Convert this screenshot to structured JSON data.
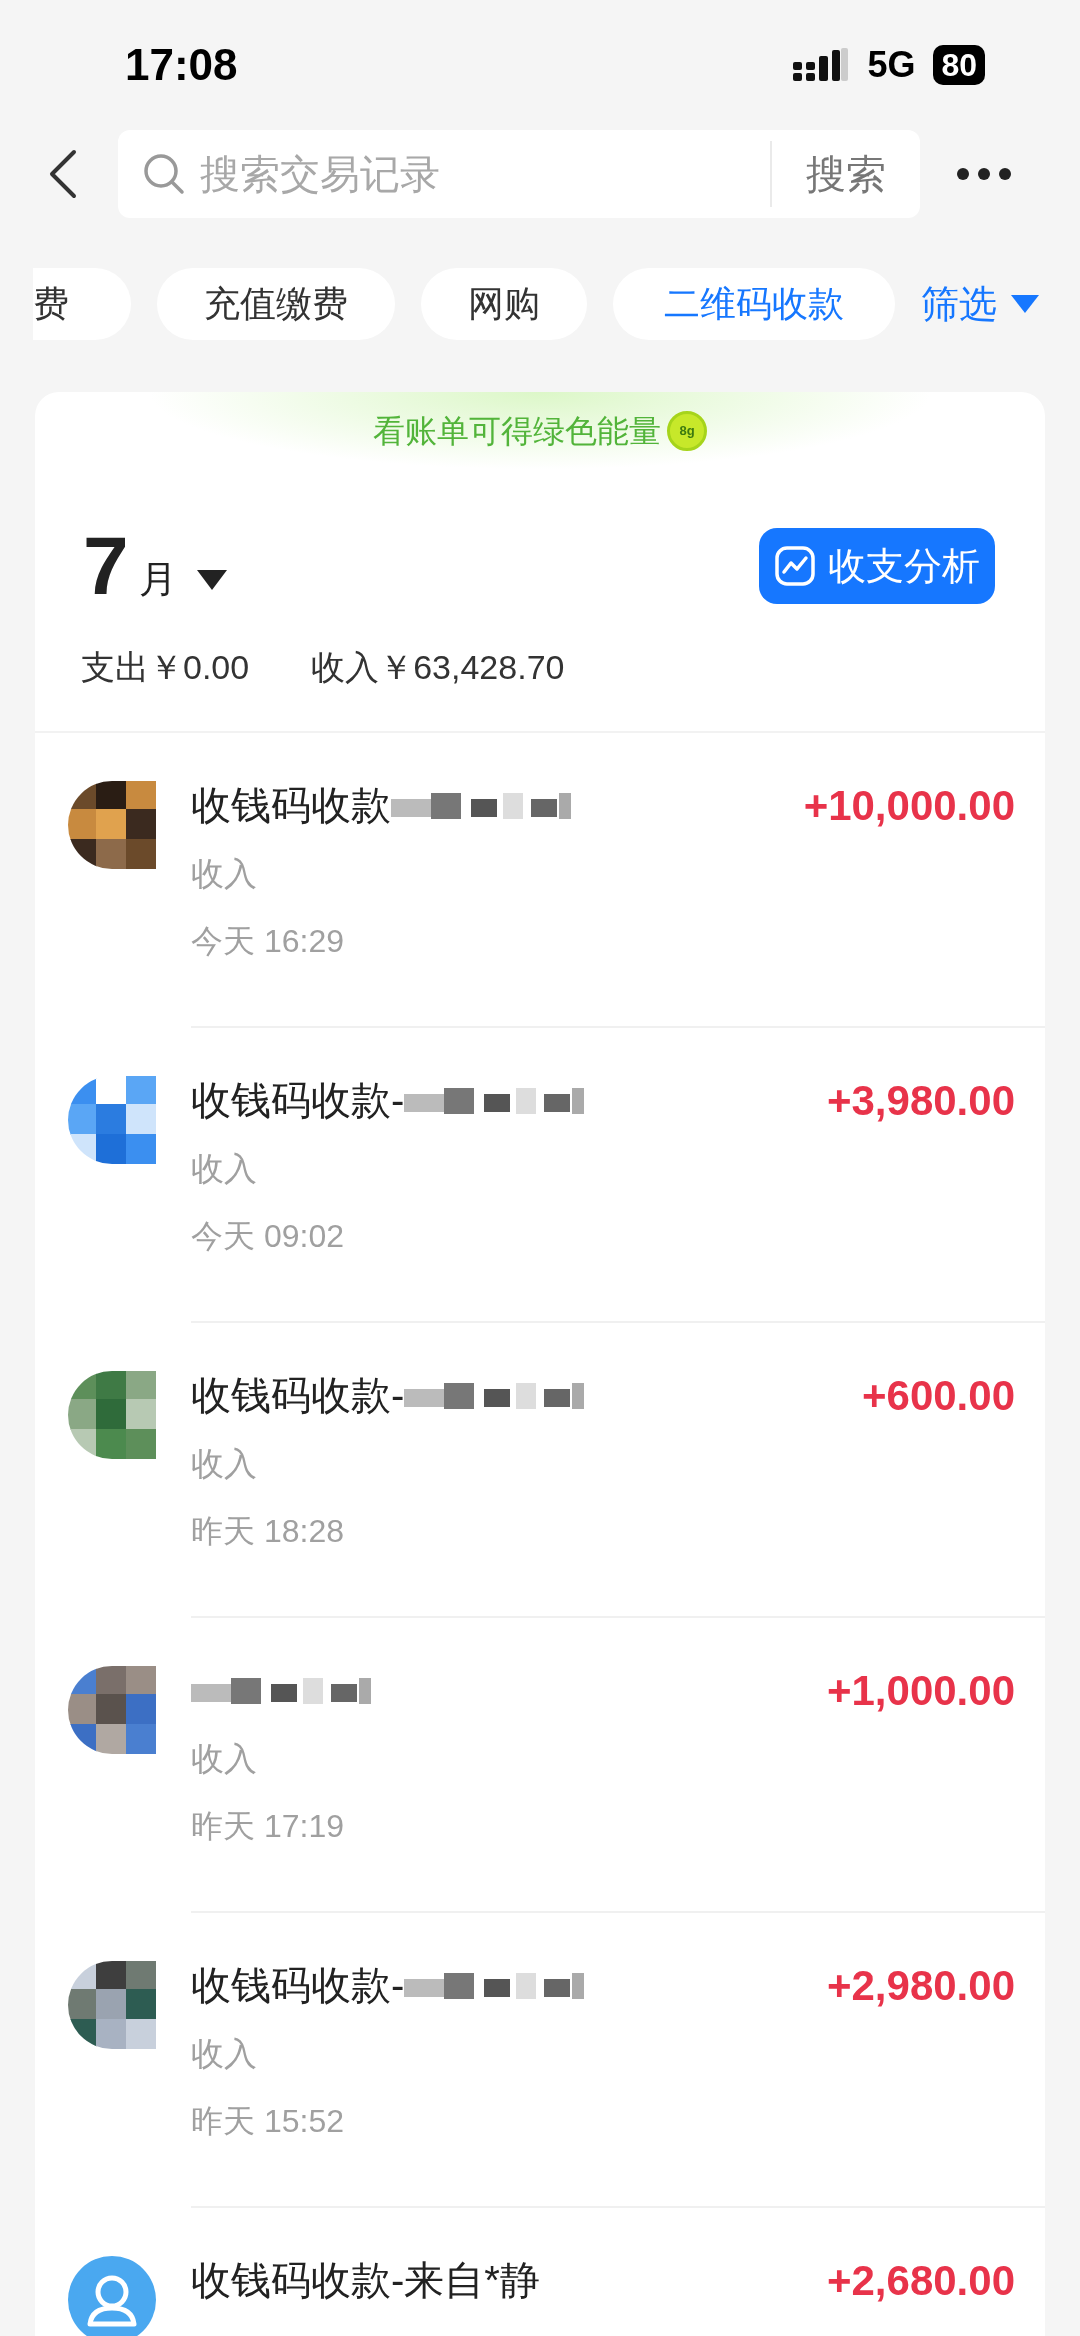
{
  "status_bar": {
    "time": "17:08",
    "network": "5G",
    "battery": "80"
  },
  "search": {
    "placeholder": "搜索交易记录",
    "button": "搜索"
  },
  "tabs": [
    {
      "label": "费",
      "selected": false
    },
    {
      "label": "充值缴费",
      "selected": false
    },
    {
      "label": "网购",
      "selected": false
    },
    {
      "label": "二维码收款",
      "selected": true
    }
  ],
  "filter": "筛选",
  "banner": {
    "text": "看账单可得绿色能量",
    "coin": "8g"
  },
  "month": {
    "number": "7",
    "unit": "月"
  },
  "analysis_button": "收支分析",
  "totals": {
    "expense": "支出￥0.00",
    "income": "收入￥63,428.70"
  },
  "rows": [
    {
      "kind": "picture",
      "title": "收钱码收款",
      "redacted": true,
      "category": "收入",
      "time": "今天 16:29",
      "amount": "+10,000.00"
    },
    {
      "kind": "picture",
      "title": "收钱码收款-",
      "redacted": true,
      "category": "收入",
      "time": "今天 09:02",
      "amount": "+3,980.00"
    },
    {
      "kind": "picture",
      "title": "收钱码收款-",
      "redacted": true,
      "category": "收入",
      "time": "昨天 18:28",
      "amount": "+600.00"
    },
    {
      "kind": "picture",
      "redacted": true,
      "category": "收入",
      "time": "昨天 17:19",
      "amount": "+1,000.00"
    },
    {
      "kind": "picture",
      "title": "收钱码收款-",
      "redacted": true,
      "category": "收入",
      "time": "昨天 15:52",
      "amount": "+2,980.00"
    },
    {
      "kind": "person",
      "title": "收钱码收款-来自*静",
      "redacted": false,
      "amount": "+2,680.00"
    }
  ]
}
